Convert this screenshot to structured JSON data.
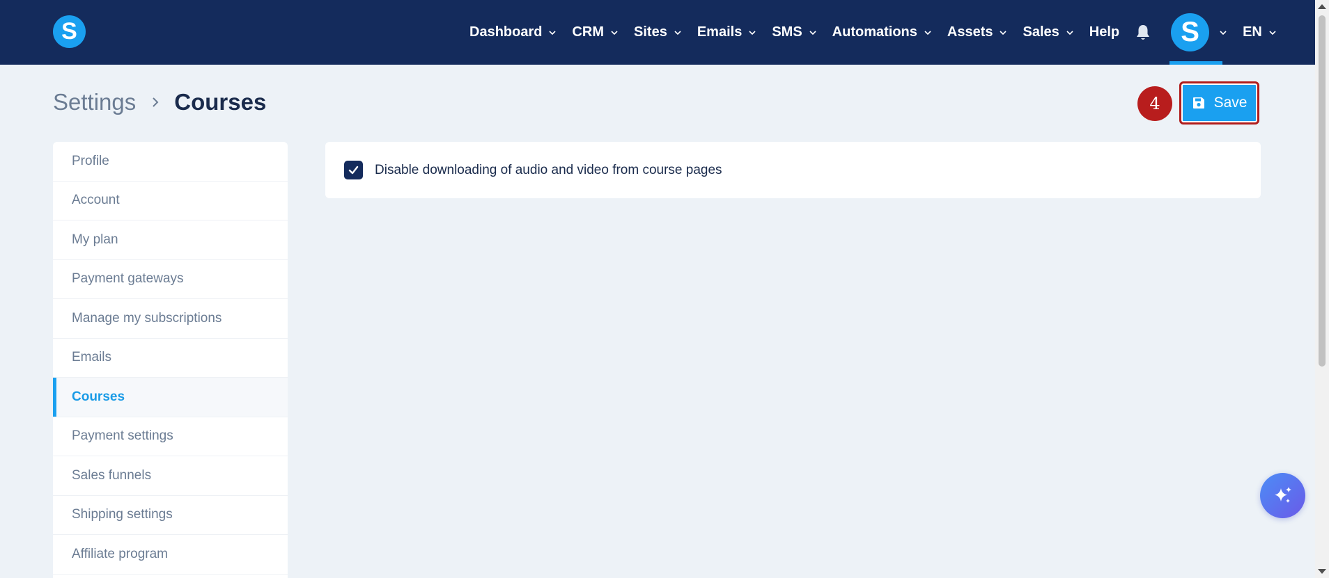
{
  "brand": {
    "logo_letter": "S"
  },
  "nav": {
    "items": [
      {
        "label": "Dashboard",
        "dropdown": true
      },
      {
        "label": "CRM",
        "dropdown": true
      },
      {
        "label": "Sites",
        "dropdown": true
      },
      {
        "label": "Emails",
        "dropdown": true
      },
      {
        "label": "SMS",
        "dropdown": true
      },
      {
        "label": "Automations",
        "dropdown": true
      },
      {
        "label": "Assets",
        "dropdown": true
      },
      {
        "label": "Sales",
        "dropdown": true
      },
      {
        "label": "Help",
        "dropdown": false
      }
    ],
    "notifications_icon": "bell-icon",
    "avatar_letter": "S",
    "language": "EN"
  },
  "breadcrumb": {
    "parent": "Settings",
    "current": "Courses"
  },
  "toolbar": {
    "step_number": "4",
    "save_label": "Save",
    "save_icon": "floppy-disk-icon"
  },
  "sidebar": {
    "items": [
      {
        "label": "Profile",
        "active": false
      },
      {
        "label": "Account",
        "active": false
      },
      {
        "label": "My plan",
        "active": false
      },
      {
        "label": "Payment gateways",
        "active": false
      },
      {
        "label": "Manage my subscriptions",
        "active": false
      },
      {
        "label": "Emails",
        "active": false
      },
      {
        "label": "Courses",
        "active": true
      },
      {
        "label": "Payment settings",
        "active": false
      },
      {
        "label": "Sales funnels",
        "active": false
      },
      {
        "label": "Shipping settings",
        "active": false
      },
      {
        "label": "Affiliate program",
        "active": false
      }
    ]
  },
  "settings": {
    "disable_download": {
      "label": "Disable downloading of audio and video from course pages",
      "checked": true
    }
  },
  "ai_button": {
    "icon": "sparkles-icon"
  },
  "colors": {
    "nav_bg": "#142b5c",
    "accent": "#1aa0f0",
    "badge": "#b81d1d",
    "page_bg": "#edf2f7"
  }
}
